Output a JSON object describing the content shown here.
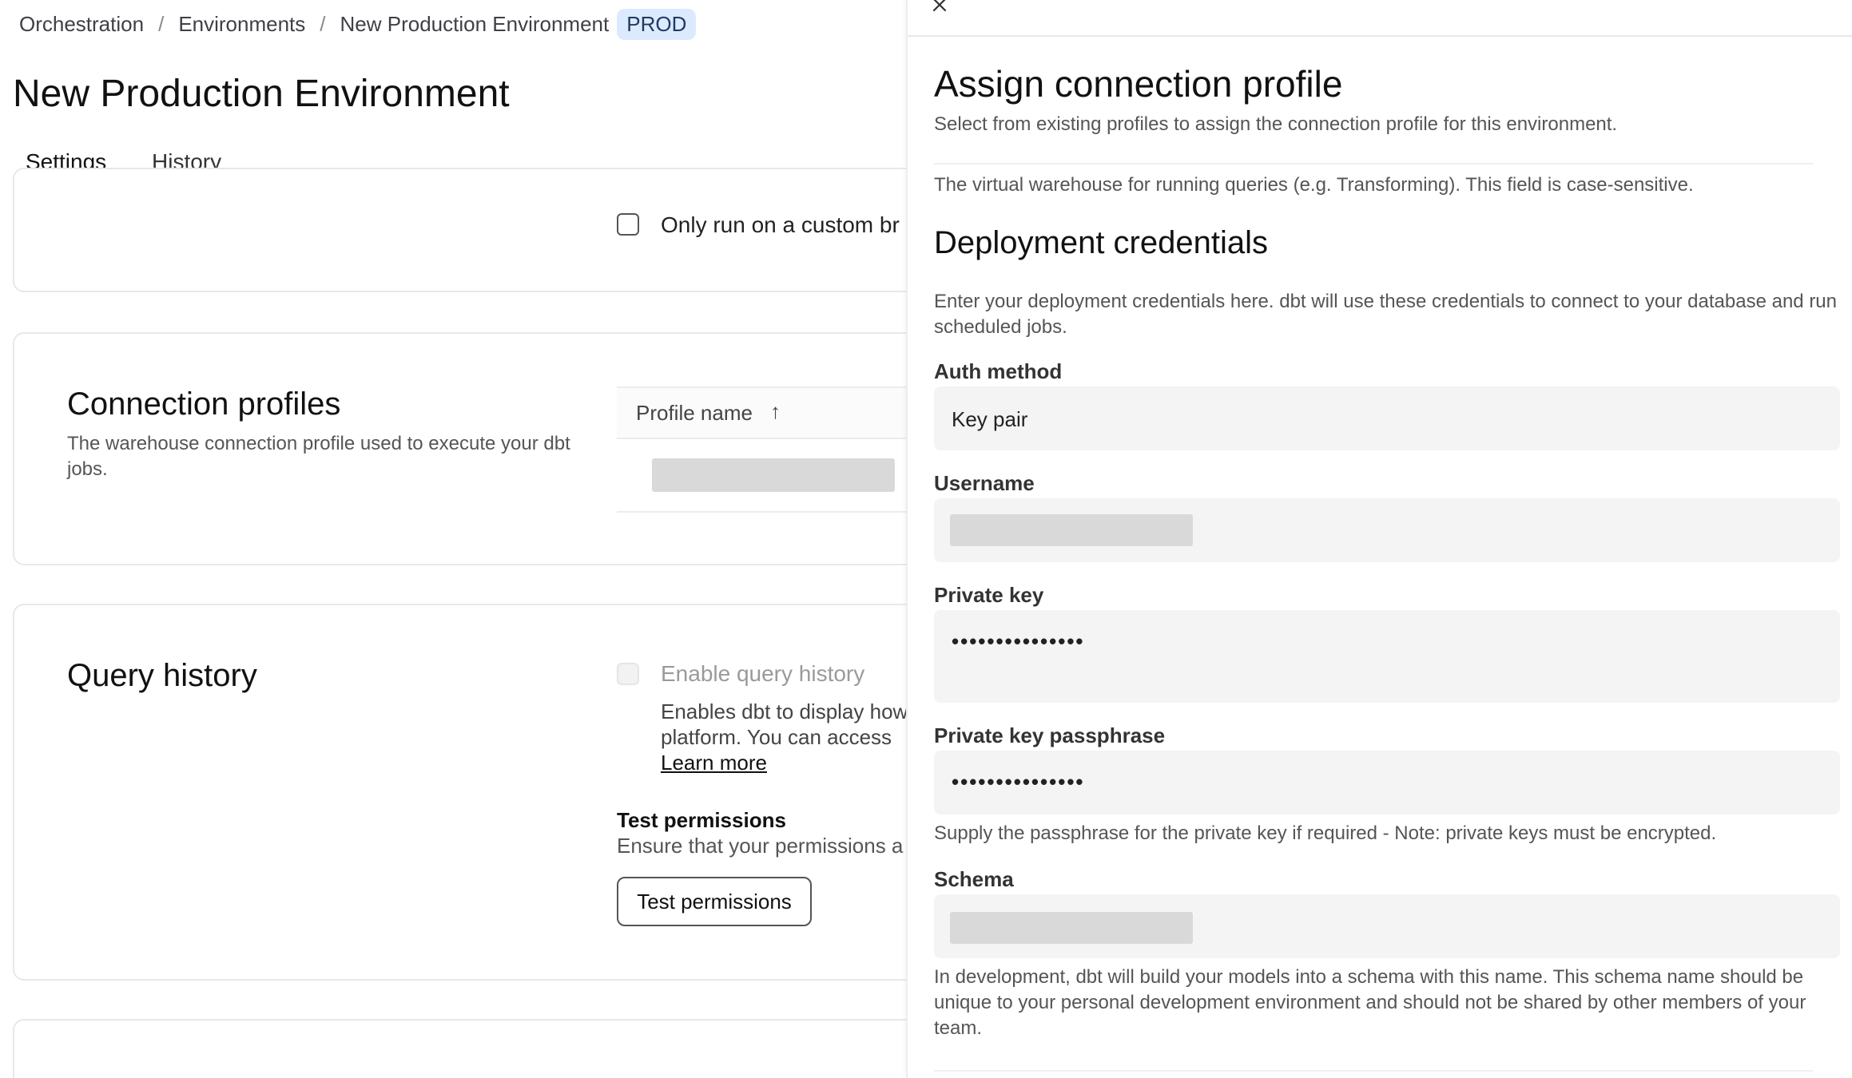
{
  "breadcrumb": {
    "items": [
      "Orchestration",
      "Environments",
      "New Production Environment"
    ],
    "separator": "/",
    "badge": "PROD"
  },
  "page": {
    "title": "New Production Environment",
    "tabs": [
      {
        "label": "Settings",
        "active": true
      },
      {
        "label": "History",
        "active": false
      }
    ]
  },
  "settings": {
    "custom_branch_label": "Only run on a custom br",
    "connection_profiles": {
      "title": "Connection profiles",
      "description": "The warehouse connection profile used to execute your dbt jobs.",
      "column_header": "Profile name",
      "sort_glyph": "↑"
    },
    "query_history": {
      "title": "Query history",
      "enable_label": "Enable query history",
      "enable_desc": "Enables dbt to display how",
      "enable_desc_2": "platform. You can access",
      "learn_more": "Learn more",
      "test_title": "Test permissions",
      "test_desc": "Ensure that your permissions a",
      "test_button": "Test permissions"
    }
  },
  "panel": {
    "close_glyph": "×",
    "title": "Assign connection profile",
    "subtitle": "Select from existing profiles to assign the connection profile for this environment.",
    "warehouse_help": "The virtual warehouse for running queries (e.g. Transforming). This field is case-sensitive.",
    "credentials": {
      "title": "Deployment credentials",
      "description": "Enter your deployment credentials here. dbt will use these credentials to connect to your database and run scheduled jobs.",
      "auth_method_label": "Auth method",
      "auth_method_value": "Key pair",
      "username_label": "Username",
      "private_key_label": "Private key",
      "private_key_value": "•••••••••••••••",
      "passphrase_label": "Private key passphrase",
      "passphrase_value": "•••••••••••••••",
      "passphrase_help": "Supply the passphrase for the private key if required - Note: private keys must be encrypted.",
      "schema_label": "Schema",
      "schema_help": "In development, dbt will build your models into a schema with this name. This schema name should be unique to your personal development environment and should not be shared by other members of your team."
    }
  }
}
